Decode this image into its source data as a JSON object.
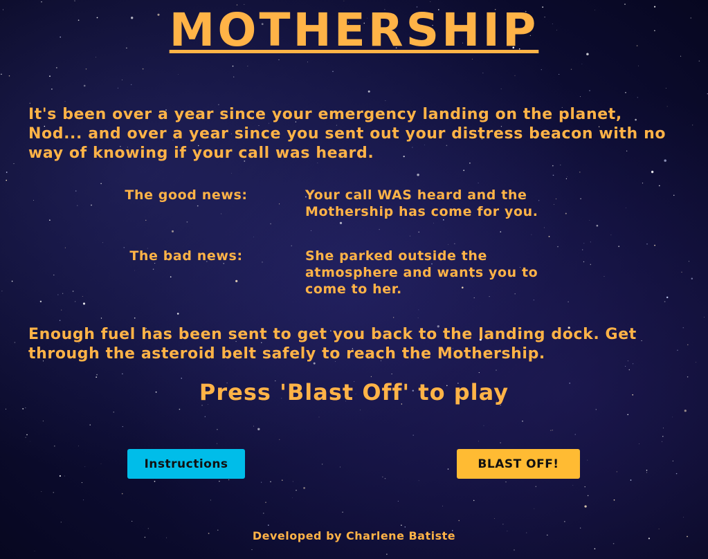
{
  "game": {
    "title": "MOTHERSHIP",
    "intro": "It's been over a year since your emergency landing on the planet, Nod... and over a year since you sent out your distress beacon with no way of knowing if your call was heard.",
    "good_news": {
      "label": "The good news:",
      "text": "Your call WAS heard and the Mothership has come for you."
    },
    "bad_news": {
      "label": "The bad news:",
      "text": "She parked outside the atmosphere and wants you to come to her."
    },
    "instructions_text": "Enough fuel has been sent to get you back to the landing dock. Get through the asteroid belt safely to reach the Mothership.",
    "prompt": "Press 'Blast Off' to play",
    "buttons": {
      "instructions": "Instructions",
      "blast_off": "BLAST OFF!"
    },
    "footer": "Developed by Charlene Batiste"
  },
  "colors": {
    "text": "#ffb347",
    "background": "#0d0d33",
    "instructions_button": "#00bde9",
    "blast_off_button": "#ffbb33"
  }
}
